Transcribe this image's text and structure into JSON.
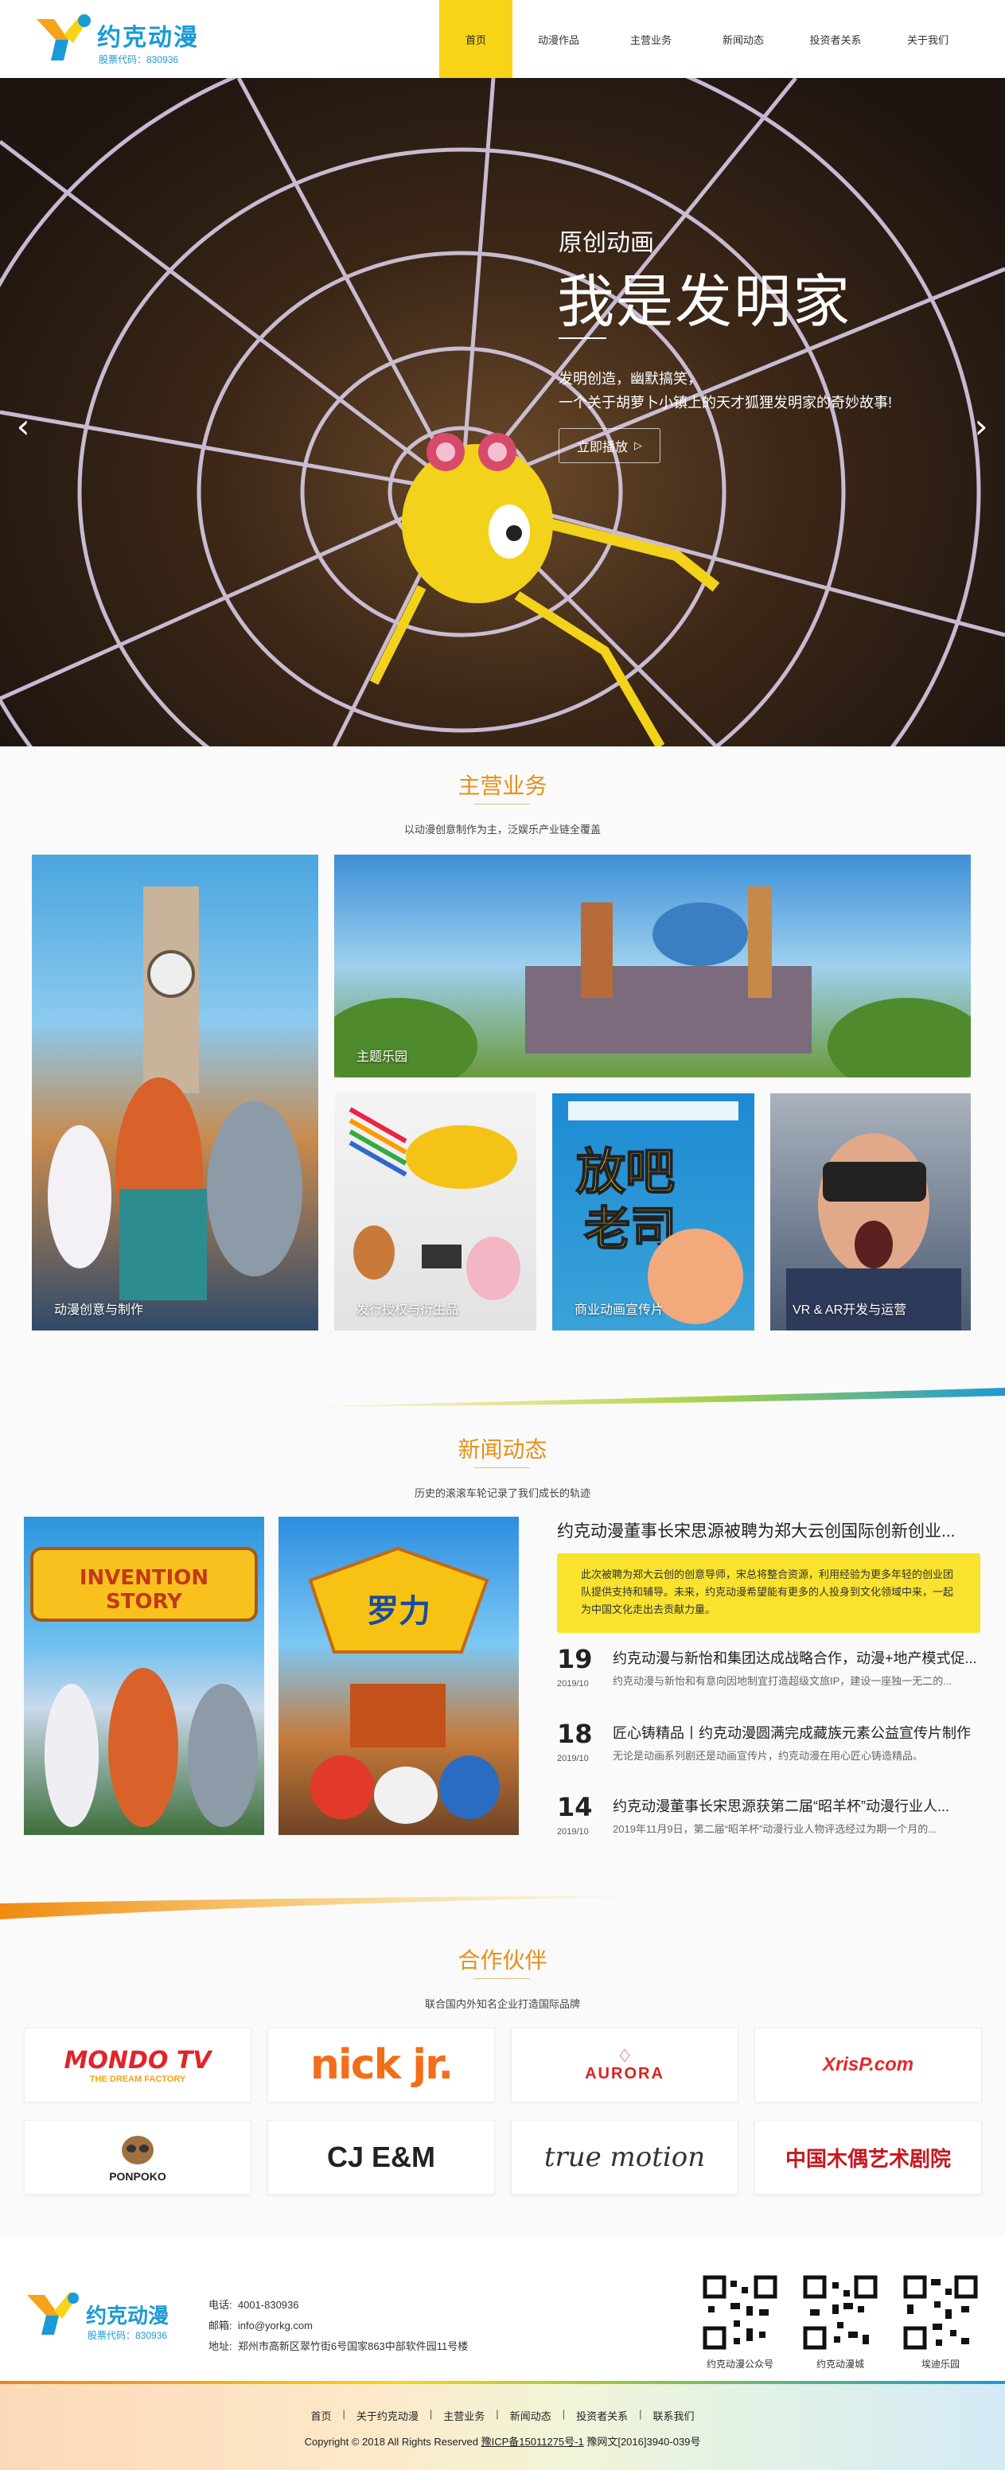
{
  "header": {
    "logo_name": "约克动漫",
    "logo_code": "股票代码：830936",
    "nav": [
      "首页",
      "动漫作品",
      "主营业务",
      "新闻动态",
      "投资者关系",
      "关于我们"
    ]
  },
  "hero": {
    "subtitle": "原创动画",
    "title": "我是发明家",
    "desc1": "发明创造，幽默搞笑，",
    "desc2": "一个关于胡萝卜小镇上的天才狐狸发明家的奇妙故事!",
    "button": "立即播放",
    "button_icon": "play-triangle-icon",
    "prev_icon": "chevron-left-icon",
    "next_icon": "chevron-right-icon"
  },
  "business": {
    "title": "主营业务",
    "desc": "以动漫创意制作为主，泛娱乐产业链全覆盖",
    "tiles": [
      "动漫创意与制作",
      "主题乐园",
      "发行授权与衍生品",
      "商业动画宣传片",
      "VR & AR开发与运营"
    ]
  },
  "news": {
    "title": "新闻动态",
    "desc": "历史的滚滚车轮记录了我们成长的轨迹",
    "headline": "约克动漫董事长宋思源被聘为郑大云创国际创新创业...",
    "headline_summary": "此次被聘为郑大云创的创意导师，宋总将整合资源，利用经验为更多年轻的创业团队提供支持和辅导。未来，约克动漫希望能有更多的人投身到文化领域中来，一起为中国文化走出去贡献力量。",
    "items": [
      {
        "day": "19",
        "ym": "2019/10",
        "title": "约克动漫与新怡和集团达成战略合作，动漫+地产模式促...",
        "summary": "约克动漫与新怡和有意向因地制宜打造超级文旅IP，建设一座独一无二的..."
      },
      {
        "day": "18",
        "ym": "2019/10",
        "title": "匠心铸精品丨约克动漫圆满完成藏族元素公益宣传片制作",
        "summary": "无论是动画系列剧还是动画宣传片，约克动漫在用心匠心铸造精品。"
      },
      {
        "day": "14",
        "ym": "2019/10",
        "title": "约克动漫董事长宋思源获第二届“昭羊杯”动漫行业人...",
        "summary": "2019年11月9日，第二届“昭羊杯”动漫行业人物评选经过为期一个月的..."
      }
    ],
    "img1_text": "INVENTION STORY",
    "img2_text": "罗力"
  },
  "partners": {
    "title": "合作伙伴",
    "desc": "联合国内外知名企业打造国际品牌",
    "logos": [
      "MONDO TV",
      "THE DREAM FACTORY",
      "nick jr.",
      "AURORA",
      "XrisP.com",
      "PONPOKO",
      "CJ E&M",
      "true motion",
      "中国木偶艺术剧院"
    ]
  },
  "footer": {
    "logo_name": "约克动漫",
    "logo_code": "股票代码：830936",
    "phone_label": "电话:",
    "phone": "4001-830936",
    "email_label": "邮箱:",
    "email": "info@yorkg.com",
    "addr_label": "地址:",
    "addr": "郑州市高新区翠竹街6号国家863中部软件园11号楼",
    "qr_captions": [
      "约克动漫公众号",
      "约克动漫城",
      "埃迪乐园"
    ],
    "nav": [
      "首页",
      "关于约克动漫",
      "主营业务",
      "新闻动态",
      "投资者关系",
      "联系我们"
    ],
    "copyright": "Copyright © 2018 All Rights Reserved ",
    "icp": "豫ICP备15011275号-1",
    "wenhua": " 豫网文[2016]3940-039号"
  },
  "colors": {
    "accent_yellow": "#f7d417",
    "heading_orange": "#e89018",
    "brand_blue": "#1a9ad6"
  }
}
